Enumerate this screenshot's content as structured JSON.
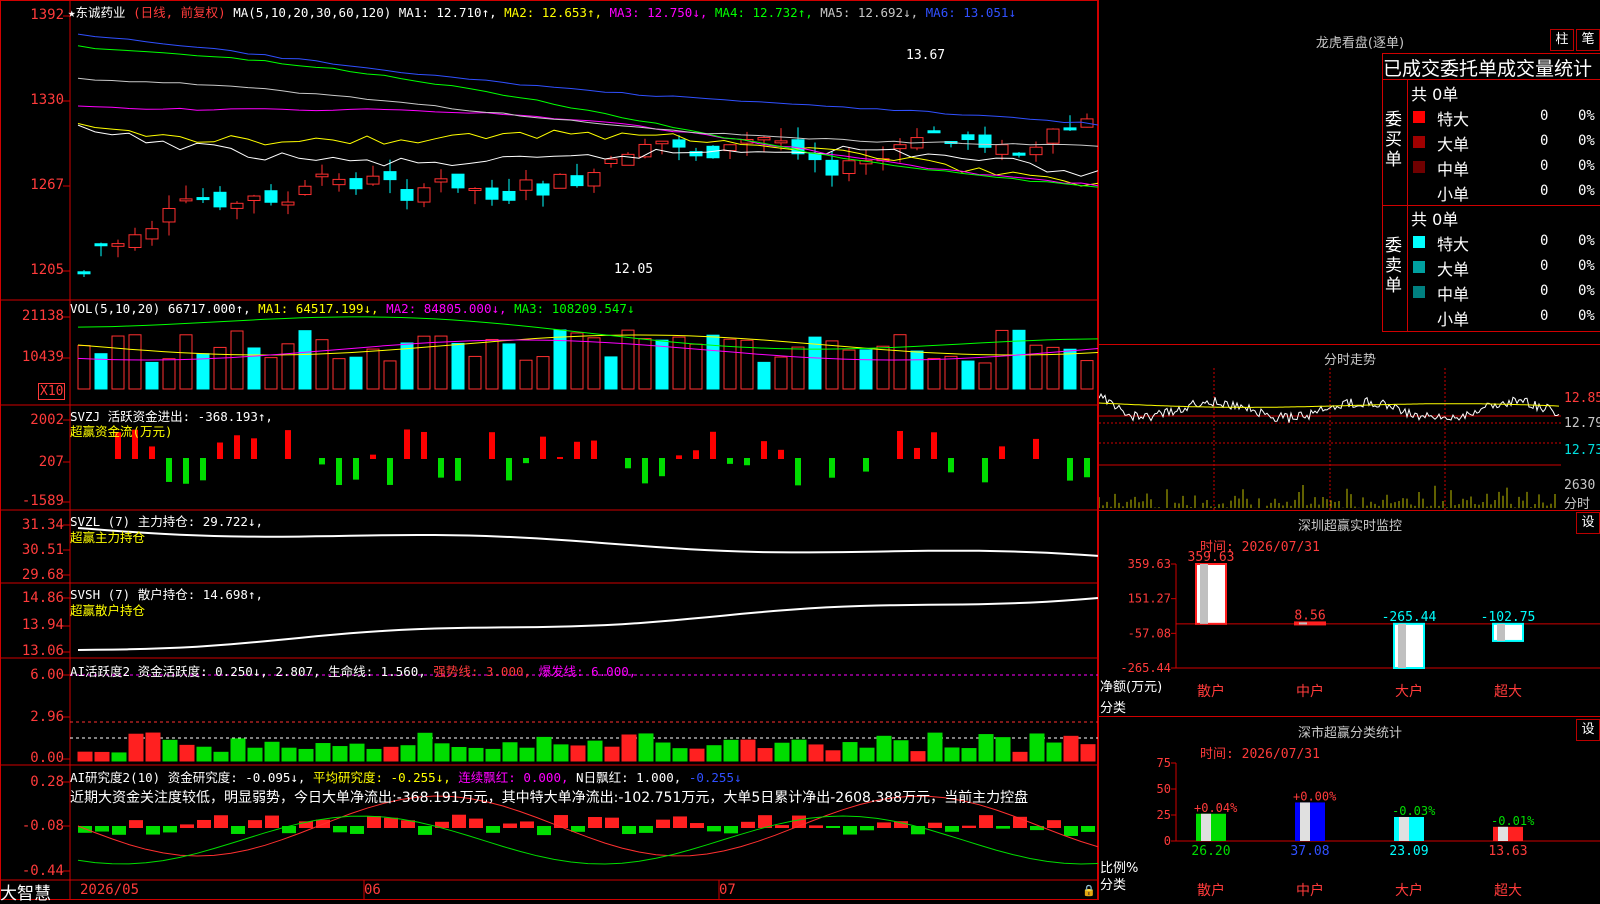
{
  "app": {
    "brand": "大智慧"
  },
  "stock": {
    "name": "★东诚药业",
    "mode": "(日线, 前复权)",
    "ma_label": "MA(5,10,20,30,60,120)",
    "ma1": "MA1: 12.710↑,",
    "ma2": "MA2: 12.653↑,",
    "ma3": "MA3: 12.750↓,",
    "ma4": "MA4: 12.732↑,",
    "ma5": "MA5: 12.692↓,",
    "ma6": "MA6: 13.051↓",
    "high_note": "13.67",
    "low_note": "12.05",
    "yticks": [
      "1392",
      "1330",
      "1267",
      "1205"
    ]
  },
  "volume": {
    "label": "VOL(5,10,20)",
    "value": "66717.000↑,",
    "ma1": "MA1: 64517.199↓,",
    "ma2": "MA2: 84805.000↓,",
    "ma3": "MA3: 108209.547↓",
    "yticks": [
      "21138",
      "10439"
    ],
    "unit": "X10"
  },
  "svzj": {
    "label": "SVZJ  活跃资金进出: -368.193↑,",
    "sub": "超赢资金流(万元)",
    "yticks": [
      "2002",
      "207",
      "-1589"
    ]
  },
  "svzl": {
    "label": "SVZL (7) 主力持仓: 29.722↓,",
    "sub": "超赢主力持仓",
    "yticks": [
      "31.34",
      "30.51",
      "29.68"
    ]
  },
  "svsh": {
    "label": "SVSH (7) 散户持仓: 14.698↑,",
    "sub": "超赢散户持仓",
    "yticks": [
      "14.86",
      "13.94",
      "13.06"
    ]
  },
  "ai_act": {
    "label": "AI活跃度2 资金活跃度: 0.250↓,",
    "v2": "2.807,",
    "life": "生命线: 1.560,",
    "strong": "强势线: 3.000,",
    "burst": "爆发线: 6.000,",
    "yticks": [
      "6.00",
      "2.96",
      "0.00"
    ]
  },
  "ai_res": {
    "label": "AI研究度2(10) 资金研究度: -0.095↓,",
    "avg": "平均研究度: -0.255↓,",
    "red1": "连续飘红: 0.000,",
    "red2": "N日飘红: 1.000,",
    "last": "-0.255↓",
    "yticks": [
      "0.28",
      "-0.08",
      "-0.44"
    ],
    "comment": "近期大资金关注度较低，明显弱势，今日大单净流出:-368.191万元，其中特大单净流出:-102.751万元，大单5日累计净出-2608.388万元，当前主力控盘"
  },
  "xaxis": {
    "labels": [
      "2026/05",
      "06",
      "07"
    ]
  },
  "longhu": {
    "title": "龙虎看盘(逐单)",
    "btn1": "柱",
    "btn2": "笔",
    "header": "已成交委托单成交量统计",
    "buy_label": "委买单",
    "sell_label": "委卖单",
    "buy_total": "共 0单",
    "sell_total": "共 0单",
    "buy_rows": [
      {
        "name": "特大",
        "count": "0",
        "pct": "0%",
        "color": "#ff0000"
      },
      {
        "name": "大单",
        "count": "0",
        "pct": "0%",
        "color": "#a00000"
      },
      {
        "name": "中单",
        "count": "0",
        "pct": "0%",
        "color": "#700000"
      },
      {
        "name": "小单",
        "count": "0",
        "pct": "0%",
        "color": ""
      }
    ],
    "sell_rows": [
      {
        "name": "特大",
        "count": "0",
        "pct": "0%",
        "color": "#00ffff"
      },
      {
        "name": "大单",
        "count": "0",
        "pct": "0%",
        "color": "#00a0a0"
      },
      {
        "name": "中单",
        "count": "0",
        "pct": "0%",
        "color": "#008080"
      },
      {
        "name": "小单",
        "count": "0",
        "pct": "0%",
        "color": ""
      }
    ]
  },
  "intraday": {
    "title": "分时走势",
    "prices": [
      "12.85",
      "12.79",
      "12.73"
    ],
    "vol": "2630",
    "vol_unit": "分时"
  },
  "monitor": {
    "title": "深圳超赢实时监控",
    "settings": "设",
    "time": "时间: 2026/07/31",
    "yticks": [
      "359.63",
      "151.27",
      "-57.08",
      "-265.44"
    ],
    "ylabel": "净额(万元)",
    "xlabel": "分类",
    "bars": [
      {
        "cat": "散户",
        "val": 359.63,
        "label": "359.63"
      },
      {
        "cat": "中户",
        "val": 8.56,
        "label": "8.56"
      },
      {
        "cat": "大户",
        "val": -265.44,
        "label": "-265.44"
      },
      {
        "cat": "超大",
        "val": -102.75,
        "label": "-102.75"
      }
    ]
  },
  "classify": {
    "title": "深市超赢分类统计",
    "settings": "设",
    "time": "时间: 2026/07/31",
    "yticks": [
      "75",
      "50",
      "25",
      "0"
    ],
    "ylabel": "比例%",
    "xlabel": "分类",
    "bars": [
      {
        "cat": "散户",
        "val": 26.2,
        "label": "26.20",
        "chg": "+0.04%"
      },
      {
        "cat": "中户",
        "val": 37.08,
        "label": "37.08",
        "chg": "+0.00%"
      },
      {
        "cat": "大户",
        "val": 23.09,
        "label": "23.09",
        "chg": "-0.03%"
      },
      {
        "cat": "超大",
        "val": 13.63,
        "label": "13.63",
        "chg": "-0.01%"
      }
    ]
  }
}
